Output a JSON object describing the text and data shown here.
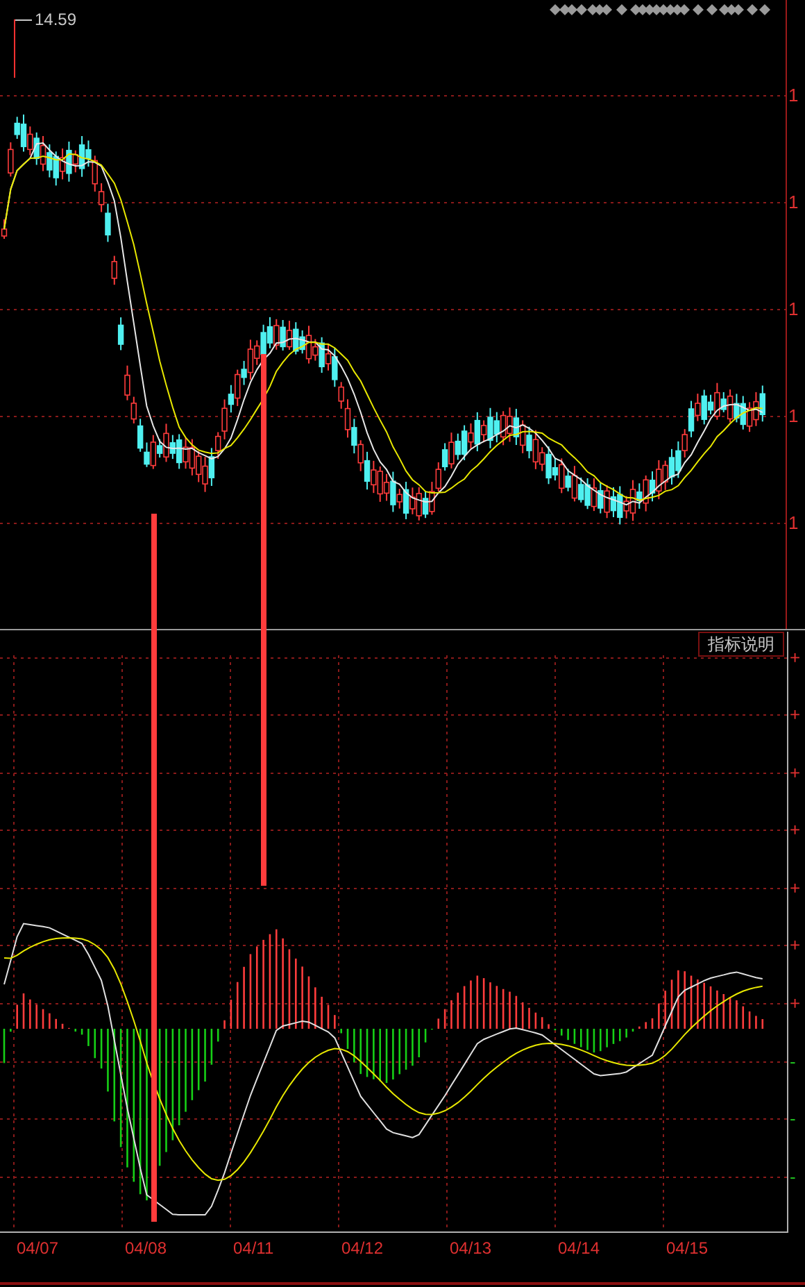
{
  "price_panel": {
    "high_marker": "14.59",
    "axis_labels": [
      "1",
      "1",
      "1",
      "1",
      "1"
    ]
  },
  "indicator_panel": {
    "help_button": "指标说明",
    "axis_labels": [
      {
        "text": "+",
        "kind": "positive"
      },
      {
        "text": "+",
        "kind": "positive"
      },
      {
        "text": "+",
        "kind": "positive"
      },
      {
        "text": "+",
        "kind": "positive"
      },
      {
        "text": "+",
        "kind": "positive"
      },
      {
        "text": "+",
        "kind": "positive"
      },
      {
        "text": "+",
        "kind": "positive"
      },
      {
        "text": "-",
        "kind": "negative"
      },
      {
        "text": "-",
        "kind": "negative"
      },
      {
        "text": "-",
        "kind": "negative"
      }
    ]
  },
  "date_axis": {
    "labels": [
      "04/07",
      "04/08",
      "04/11",
      "04/12",
      "04/13",
      "04/14",
      "04/15"
    ]
  }
}
